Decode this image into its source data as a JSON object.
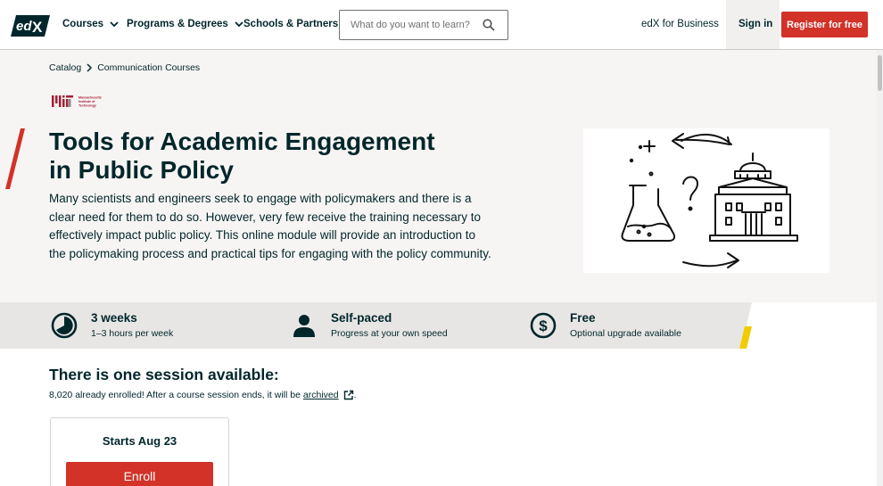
{
  "header": {
    "logo_text": "edX",
    "nav": {
      "courses": "Courses",
      "programs": "Programs & Degrees",
      "schools": "Schools & Partners"
    },
    "search_placeholder": "What do you want to learn?",
    "business_link": "edX for Business",
    "sign_in": "Sign in",
    "register": "Register for free"
  },
  "breadcrumb": {
    "items": [
      "Catalog",
      "Communication Courses"
    ]
  },
  "partner": {
    "logo_text": "Massachusetts Institute of Technology"
  },
  "course": {
    "title_line1": "Tools for Academic Engagement",
    "title_line2": "in Public Policy",
    "description": "Many scientists and engineers seek to engage with policymakers and there is a clear need for them to do so. However, very few receive the training necessary to effectively impact public policy. This online module will provide an introduction to the policymaking process and practical tips for engaging with the policy community."
  },
  "stats": [
    {
      "title": "3 weeks",
      "subtitle": "1–3 hours per week",
      "icon": "clock-icon"
    },
    {
      "title": "Self-paced",
      "subtitle": "Progress at your own speed",
      "icon": "person-icon"
    },
    {
      "title": "Free",
      "subtitle": "Optional upgrade available",
      "icon": "dollar-icon"
    }
  ],
  "sessions": {
    "heading": "There is one session available:",
    "enrolled_text": "8,020 already enrolled! After a course session ends, it will be",
    "archived_link": "archived",
    "period": ".",
    "card": {
      "starts": "Starts Aug 23",
      "enroll": "Enroll"
    }
  },
  "colors": {
    "brand_red": "#d23228",
    "ink": "#00262b",
    "hero_bg": "#f7f5f3",
    "stats_bg": "#e8e6e4",
    "accent_yellow": "#f0cc00"
  }
}
